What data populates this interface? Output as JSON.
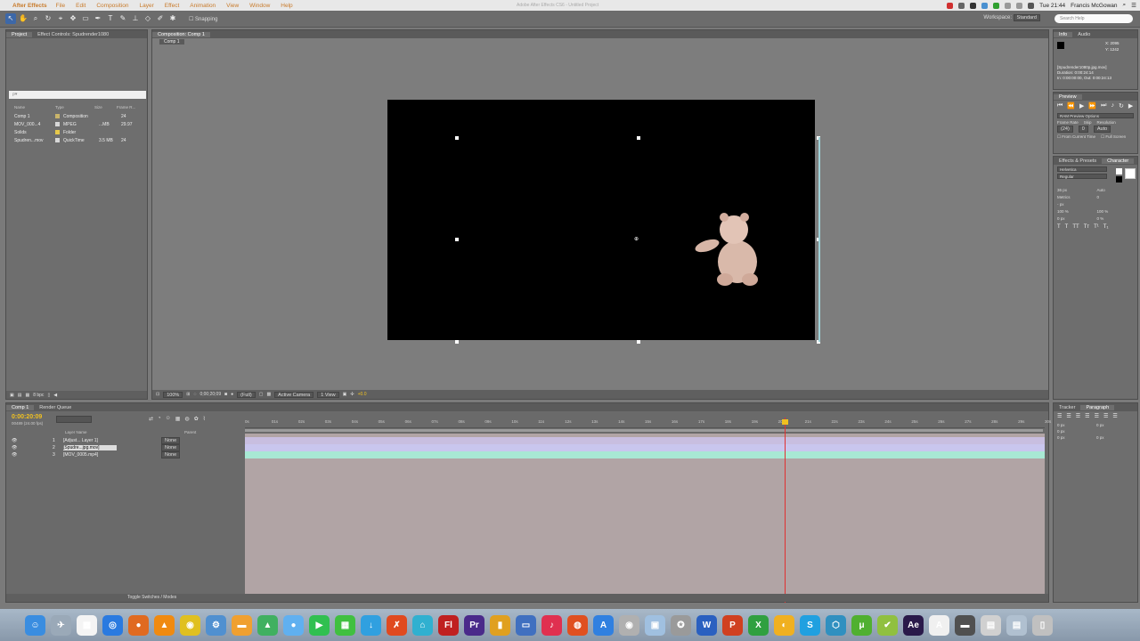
{
  "menubar": {
    "app": "After Effects",
    "items": [
      "File",
      "Edit",
      "Composition",
      "Layer",
      "Effect",
      "Animation",
      "View",
      "Window",
      "Help"
    ],
    "window_title": "Adobe After Effects CS6 - Untitled Project",
    "clock": "Tue 21:44",
    "user": "Francis McGowan"
  },
  "toolbar": {
    "snapping": "Snapping",
    "workspace_label": "Workspace:",
    "workspace_value": "Standard",
    "search_help": "Search Help"
  },
  "project_panel": {
    "tabs": [
      "Project",
      "Effect Controls: Spudrender1080"
    ],
    "search_placeholder": "ρ▾",
    "columns": [
      "Name",
      "Type",
      "Size",
      "Frame R..."
    ],
    "items": [
      {
        "name": "Comp 1",
        "type": "Composition",
        "size": "",
        "rate": "24",
        "color": "#c9b46a"
      },
      {
        "name": "MOV_000...4",
        "type": "MPEG",
        "size": "...MB",
        "rate": "29.97",
        "color": "#d7d7d7"
      },
      {
        "name": "Solids",
        "type": "Folder",
        "size": "",
        "rate": "",
        "color": "#e6c84a"
      },
      {
        "name": "Spudren...mov",
        "type": "QuickTime",
        "size": "3.5 MB",
        "rate": "24",
        "color": "#d7d7d7"
      }
    ],
    "footer_bpc": "8 bpc"
  },
  "composition": {
    "tab": "Composition: Comp 1",
    "sub_tab": "Comp 1",
    "zoom": "100%",
    "timecode": "0;00;20;09",
    "resolution": "(Full)",
    "camera": "Active Camera",
    "views": "1 View",
    "exposure": "+0.0"
  },
  "info_panel": {
    "tabs": [
      "Info",
      "Audio"
    ],
    "x_label": "X: 2095",
    "y_label": "Y: 1242",
    "source": "[Spudrender1080p.jpg.mov]",
    "duration": "Duration: 0:00:24:14",
    "in_out": "In: 0:00:00:00, Out: 0:00:24:13"
  },
  "preview_panel": {
    "tab": "Preview",
    "ram_options": "RAM Preview Options",
    "frame_rate_label": "Frame Rate",
    "skip_label": "Skip",
    "resolution_label": "Resolution",
    "frame_rate_value": "(24)",
    "skip_value": "0",
    "resolution_value": "Auto",
    "from_current": "From Current Time",
    "full_screen": "Full Screen"
  },
  "character_panel": {
    "tabs": [
      "Effects & Presets",
      "Character"
    ],
    "font": "Helvetica",
    "style": "Regular",
    "size": "36 px",
    "leading": "Auto",
    "kerning": "Metrics",
    "tracking": "0",
    "stroke": "- px",
    "vscale": "100 %",
    "hscale": "100 %",
    "baseline": "0 px",
    "tsume": "0 %"
  },
  "timeline": {
    "tabs": [
      "Comp 1",
      "Render Queue"
    ],
    "timecode": "0:00:20:09",
    "frames": "00489 (24.00 fps)",
    "columns": [
      "Layer Name",
      "Parent"
    ],
    "layers": [
      {
        "num": "1",
        "name": "[Adjust... Layer 1]",
        "parent": "None",
        "selected": false,
        "bar_color": "#c8bee0"
      },
      {
        "num": "2",
        "name": "[Spudre...jpg.mov]",
        "parent": "None",
        "selected": true,
        "bar_color": "#c9c6ee"
      },
      {
        "num": "3",
        "name": "[MOV_0005.mp4]",
        "parent": "None",
        "selected": false,
        "bar_color": "#a8e8d4"
      }
    ],
    "ruler_ticks": [
      "0s",
      "01s",
      "02s",
      "03s",
      "04s",
      "05s",
      "06s",
      "07s",
      "08s",
      "09s",
      "10s",
      "11s",
      "12s",
      "13s",
      "14s",
      "15s",
      "16s",
      "17s",
      "18s",
      "19s",
      "20s",
      "21s",
      "22s",
      "23s",
      "24s",
      "25s",
      "26s",
      "27s",
      "28s",
      "29s",
      "30s"
    ],
    "footer": "Toggle Switches / Modes"
  },
  "paragraph_panel": {
    "tabs": [
      "Tracker",
      "Paragraph"
    ],
    "indent_left": "0 px",
    "indent_right": "0 px",
    "indent_first": "0 px",
    "space_before": "0 px",
    "space_after": "0 px"
  },
  "dock": {
    "apps": [
      {
        "name": "finder",
        "color": "#3a8de0",
        "glyph": "☺"
      },
      {
        "name": "launchpad",
        "color": "#9aa9b8",
        "glyph": "✈"
      },
      {
        "name": "calendar",
        "color": "#f4f4f4",
        "glyph": "▦"
      },
      {
        "name": "safari",
        "color": "#2a7ae0",
        "glyph": "◎"
      },
      {
        "name": "firefox",
        "color": "#e06a20",
        "glyph": "●"
      },
      {
        "name": "vlc",
        "color": "#f08a10",
        "glyph": "▲"
      },
      {
        "name": "chrome",
        "color": "#e0c020",
        "glyph": "◉"
      },
      {
        "name": "app-store-util",
        "color": "#5090d0",
        "glyph": "⚙"
      },
      {
        "name": "folder",
        "color": "#f0a030",
        "glyph": "▬"
      },
      {
        "name": "drive",
        "color": "#40b060",
        "glyph": "▲"
      },
      {
        "name": "messages",
        "color": "#60b0f0",
        "glyph": "●"
      },
      {
        "name": "facetime",
        "color": "#30c050",
        "glyph": "▶"
      },
      {
        "name": "numbers",
        "color": "#40c040",
        "glyph": "▦"
      },
      {
        "name": "downloader",
        "color": "#30a0e0",
        "glyph": "↓"
      },
      {
        "name": "acrobat-x",
        "color": "#e04a20",
        "glyph": "✗"
      },
      {
        "name": "fetch",
        "color": "#30b0d0",
        "glyph": "⌂"
      },
      {
        "name": "flash",
        "color": "#c02020",
        "glyph": "Fl"
      },
      {
        "name": "premiere",
        "color": "#4a2a8a",
        "glyph": "Pr"
      },
      {
        "name": "stats",
        "color": "#e0a020",
        "glyph": "▮"
      },
      {
        "name": "keynote",
        "color": "#4070c0",
        "glyph": "▭"
      },
      {
        "name": "itunes",
        "color": "#e03050",
        "glyph": "♪"
      },
      {
        "name": "photo-booth",
        "color": "#e05020",
        "glyph": "◍"
      },
      {
        "name": "app-store",
        "color": "#3080e0",
        "glyph": "A"
      },
      {
        "name": "disk-utility",
        "color": "#b0b0b0",
        "glyph": "◉"
      },
      {
        "name": "preview",
        "color": "#a0c0e0",
        "glyph": "▣"
      },
      {
        "name": "automator",
        "color": "#9a9a9a",
        "glyph": "✪"
      },
      {
        "name": "word",
        "color": "#2a60c0",
        "glyph": "W"
      },
      {
        "name": "powerpoint",
        "color": "#d04020",
        "glyph": "P"
      },
      {
        "name": "excel",
        "color": "#30a040",
        "glyph": "X"
      },
      {
        "name": "vpn",
        "color": "#f0b020",
        "glyph": "◐"
      },
      {
        "name": "skype",
        "color": "#20a0e0",
        "glyph": "S"
      },
      {
        "name": "network",
        "color": "#3090c0",
        "glyph": "⬡"
      },
      {
        "name": "utorrent",
        "color": "#50b030",
        "glyph": "μ"
      },
      {
        "name": "android",
        "color": "#90c040",
        "glyph": "✔"
      },
      {
        "name": "after-effects",
        "color": "#2a1a4a",
        "glyph": "Ae"
      },
      {
        "name": "acrobat",
        "color": "#f0f0f0",
        "glyph": "A"
      },
      {
        "name": "screen",
        "color": "#505050",
        "glyph": "▬"
      },
      {
        "name": "documents",
        "color": "#d0d0d0",
        "glyph": "▤"
      },
      {
        "name": "downloads",
        "color": "#b0c0d0",
        "glyph": "▤"
      },
      {
        "name": "trash",
        "color": "#c0c0c0",
        "glyph": "▯"
      }
    ]
  }
}
